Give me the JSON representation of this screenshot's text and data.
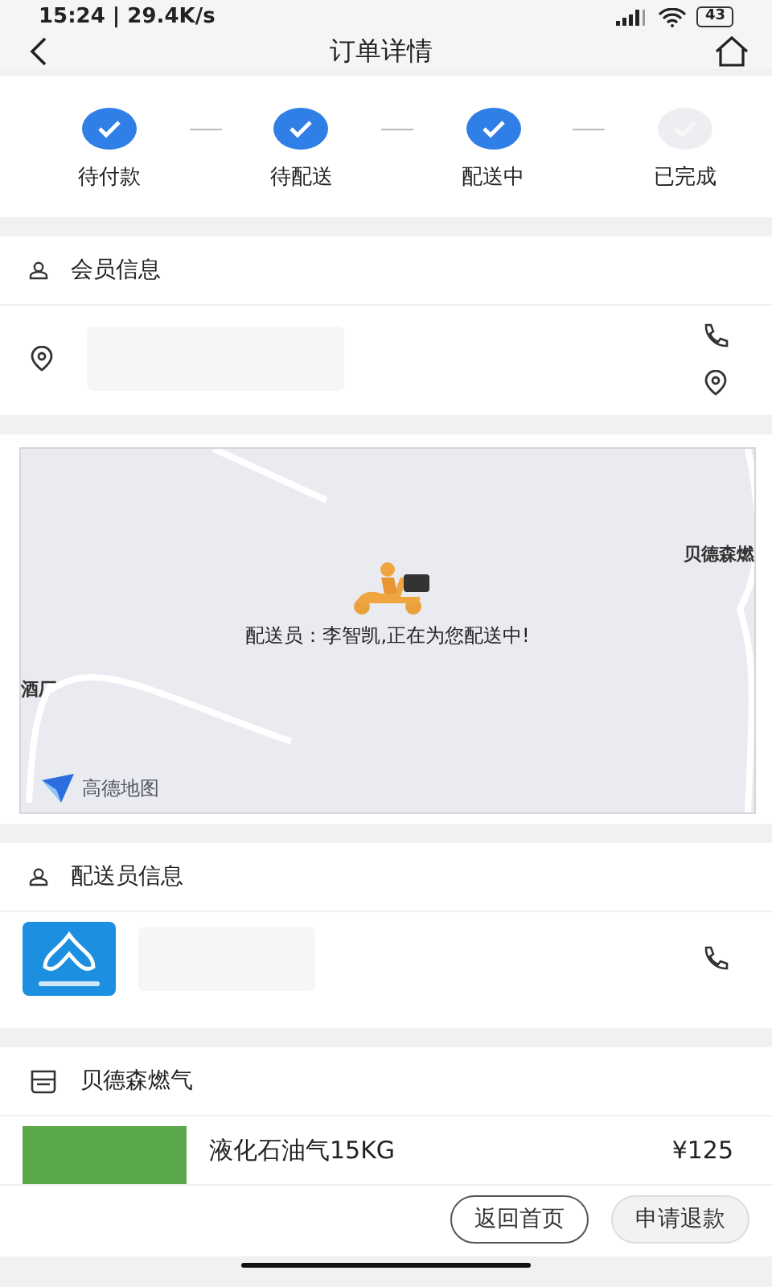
{
  "status_bar": {
    "time": "15:24 | 29.4K/s",
    "battery": "43"
  },
  "header": {
    "title": "订单详情"
  },
  "steps": [
    {
      "label": "待付款",
      "done": true
    },
    {
      "label": "待配送",
      "done": true
    },
    {
      "label": "配送中",
      "done": true
    },
    {
      "label": "已完成",
      "done": false
    }
  ],
  "member_section": {
    "title": "会员信息"
  },
  "map": {
    "message": "配送员：李智凯,正在为您配送中!",
    "places": [
      "贝德森燃",
      "酒厂"
    ],
    "provider": "高德地图"
  },
  "courier_section": {
    "title": "配送员信息"
  },
  "shop_section": {
    "title": "贝德森燃气",
    "product": {
      "name": "液化石油气15KG",
      "price": "¥125"
    }
  },
  "footer": {
    "buttons": [
      {
        "label": "返回首页",
        "kind": "outline"
      },
      {
        "label": "申请退款",
        "kind": "filled"
      }
    ]
  }
}
